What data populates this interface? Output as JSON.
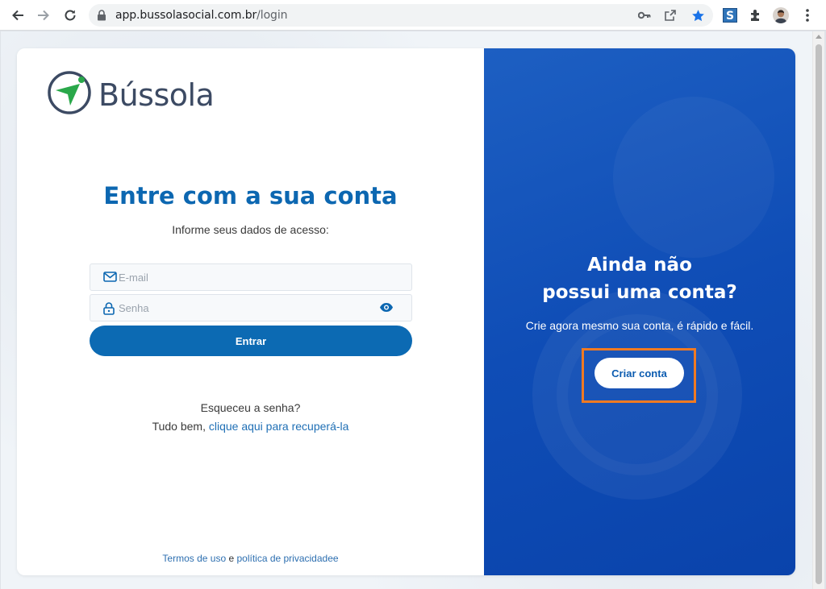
{
  "browser": {
    "url_host": "app.bussolasocial.com.br",
    "url_path": "/login"
  },
  "brand": {
    "name": "Bússola",
    "accent": "#0c67b1",
    "logo_green": "#2aa84a",
    "logo_navy": "#3c4a63"
  },
  "login": {
    "title": "Entre com a sua conta",
    "subtitle": "Informe seus dados de acesso:",
    "email_placeholder": "E-mail",
    "password_placeholder": "Senha",
    "submit_label": "Entrar",
    "forgot_line": "Esqueceu a senha?",
    "recover_prefix": "Tudo bem, ",
    "recover_link": "clique aqui para recuperá-la"
  },
  "footer": {
    "terms_link": "Termos de uso",
    "conjunction": " e ",
    "privacy_link": "política de privacidadee"
  },
  "signup": {
    "title_line1": "Ainda não",
    "title_line2": "possui uma conta?",
    "subtitle": "Crie agora mesmo sua conta, é rápido e fácil.",
    "button_label": "Criar conta",
    "panel_color": "#0f4db6",
    "highlight_color": "#f07a22"
  }
}
